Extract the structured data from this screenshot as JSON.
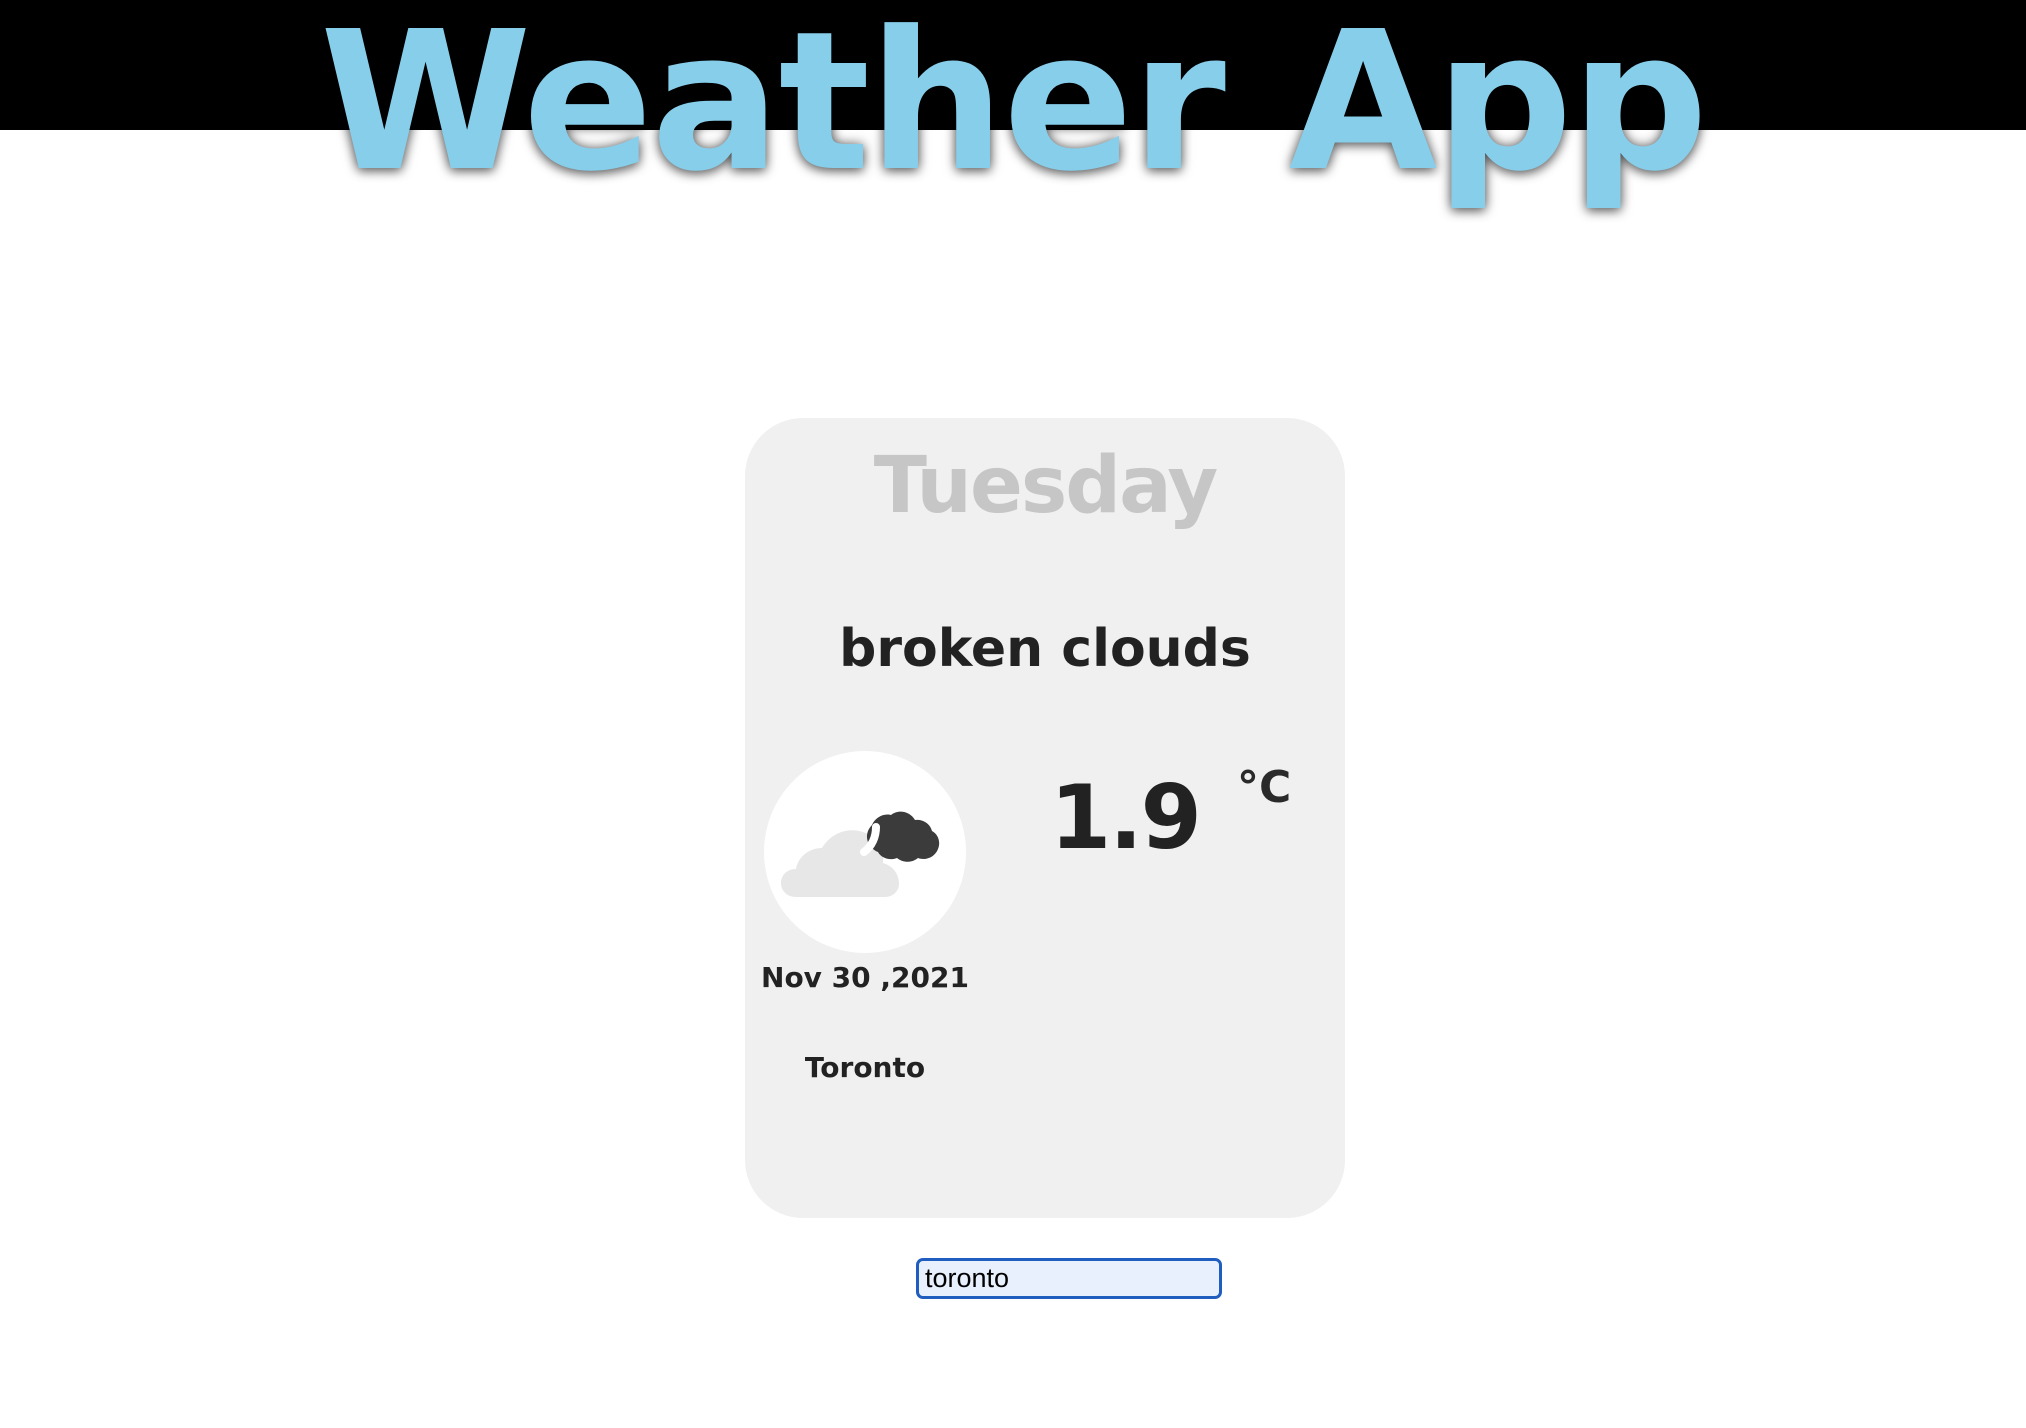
{
  "header": {
    "title": "Weather App",
    "title_color": "#87ceeb",
    "band_color": "#000000"
  },
  "weather_card": {
    "day": "Tuesday",
    "condition": "broken clouds",
    "icon": "broken-clouds-icon",
    "temperature": "1.9",
    "unit": "°C",
    "date": "Nov 30 ,2021",
    "city": "Toronto",
    "background_color": "#f0f0f0"
  },
  "search": {
    "value": "toronto",
    "border_color": "#1f5dbf",
    "background_color": "#e8f0fe"
  }
}
